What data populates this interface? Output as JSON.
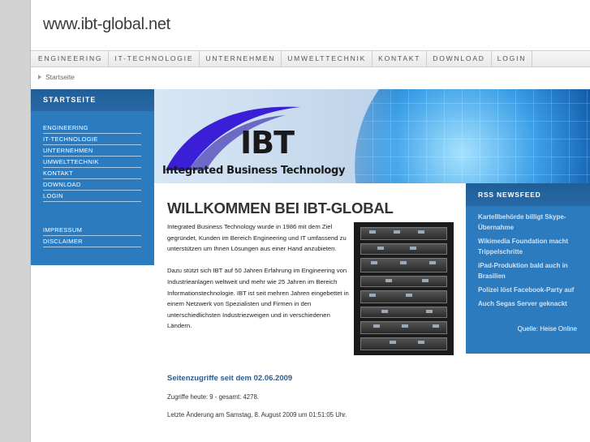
{
  "header": {
    "title": "www.ibt-global.net"
  },
  "topnav": [
    "ENGINEERING",
    "IT-TECHNOLOGIE",
    "UNTERNEHMEN",
    "UMWELTTECHNIK",
    "KONTAKT",
    "DOWNLOAD",
    "LOGIN"
  ],
  "breadcrumb": {
    "item": "Startseite"
  },
  "sidebar": {
    "heading": "STARTSEITE",
    "items": [
      "ENGINEERING",
      "IT-TECHNOLOGIE",
      "UNTERNEHMEN",
      "UMWELTTECHNIK",
      "KONTAKT",
      "DOWNLOAD",
      "LOGIN"
    ],
    "secondary": [
      "IMPRESSUM",
      "DISCLAIMER"
    ]
  },
  "banner": {
    "logo_text": "IBT",
    "tagline": "Integrated Business Technology"
  },
  "main": {
    "title": "WILLKOMMEN BEI IBT-GLOBAL",
    "paragraphs": [
      "Integrated Business Technology wurde in 1986 mit dem Ziel gegründet, Kunden im Bereich Engineering und IT umfassend zu unterstützen um Ihnen Lösungen aus einer Hand anzubieten.",
      "Dazu stützt sich IBT auf 50 Jahren Erfahrung im Engineering von Industrieanlagen weltweit und mehr wie 25 Jahren im Bereich Informationstechnologie. IBT ist seit mehren Jahren eingebettet in einem Netzwerk von Spezialisten und Firmen in den unterschiedlichsten Industriezweigen und in verschiedenen Ländern."
    ],
    "stats_title": "Seitenzugriffe seit dem 02.06.2009",
    "stats_line": "Zugriffe heute: 9 - gesamt: 4278.",
    "last_change": "Letzte Änderung am Samstag, 8. August 2009 um 01:51:05 Uhr."
  },
  "rss": {
    "heading": "RSS NEWSFEED",
    "items": [
      "Kartellbehörde billigt Skype-Übernahme",
      "Wikimedia Foundation macht Trippelschritte",
      "iPad-Produktion bald auch in Brasilien",
      "Polizei löst Facebook-Party auf",
      "Auch Segas Server geknackt"
    ],
    "source": "Quelle: Heise Online"
  },
  "colors": {
    "accent_blue": "#2d7bbf",
    "dark_blue": "#1f5f98",
    "stats_title": "#2c5d8f"
  }
}
